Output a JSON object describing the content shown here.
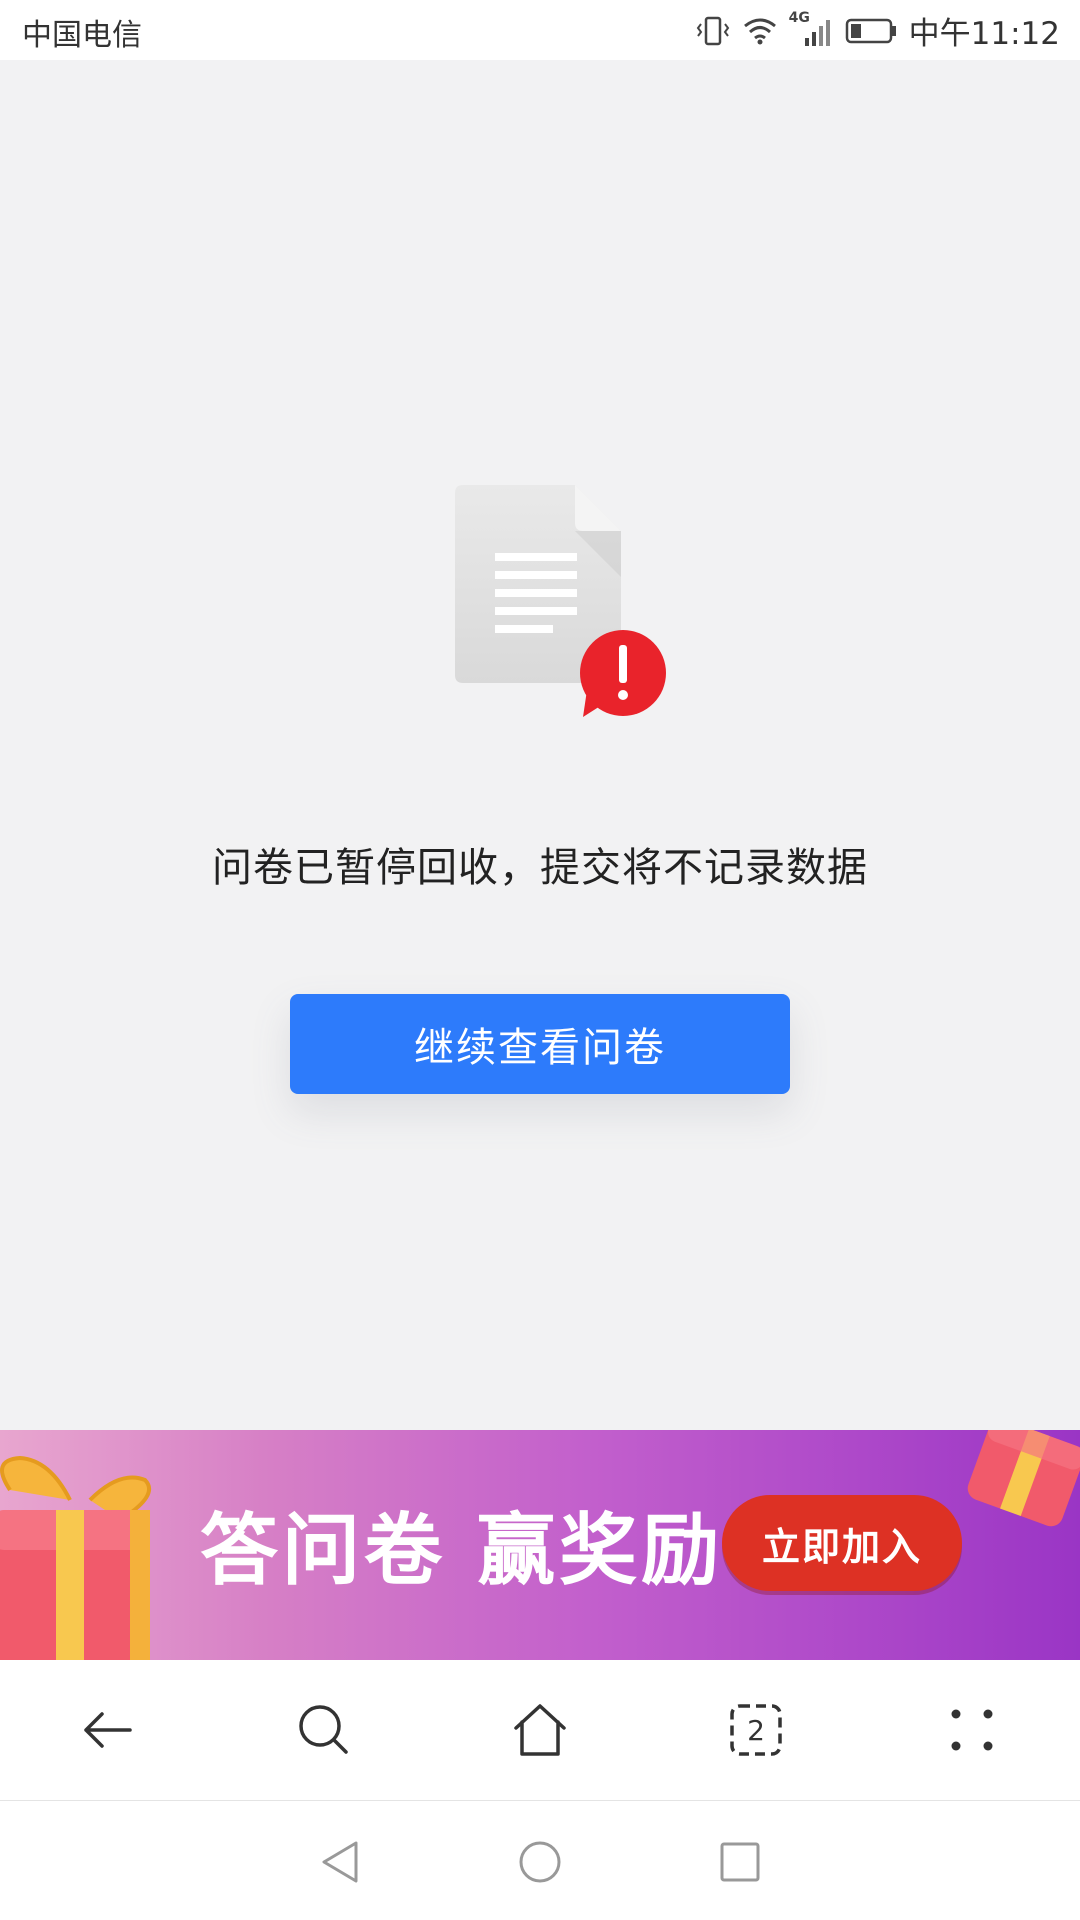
{
  "status_bar": {
    "carrier": "中国电信",
    "network": "4G",
    "time": "中午11:12",
    "icons": [
      "vibrate-icon",
      "wifi-icon",
      "signal-icon",
      "battery-icon"
    ]
  },
  "main": {
    "illustration": "document-warning-icon",
    "message": "问卷已暂停回收，提交将不记录数据",
    "continue_button": "继续查看问卷"
  },
  "promo": {
    "text": "答问卷 赢奖励",
    "button": "立即加入"
  },
  "browser_toolbar": {
    "tab_count": "2",
    "icons": [
      "back-arrow-icon",
      "search-icon",
      "home-icon",
      "tabs-icon",
      "more-icon"
    ]
  },
  "system_nav": {
    "icons": [
      "nav-back-icon",
      "nav-home-icon",
      "nav-recent-icon"
    ]
  },
  "colors": {
    "accent": "#2d7bfb",
    "warning": "#e9232b",
    "promo_button": "#dd3124"
  }
}
